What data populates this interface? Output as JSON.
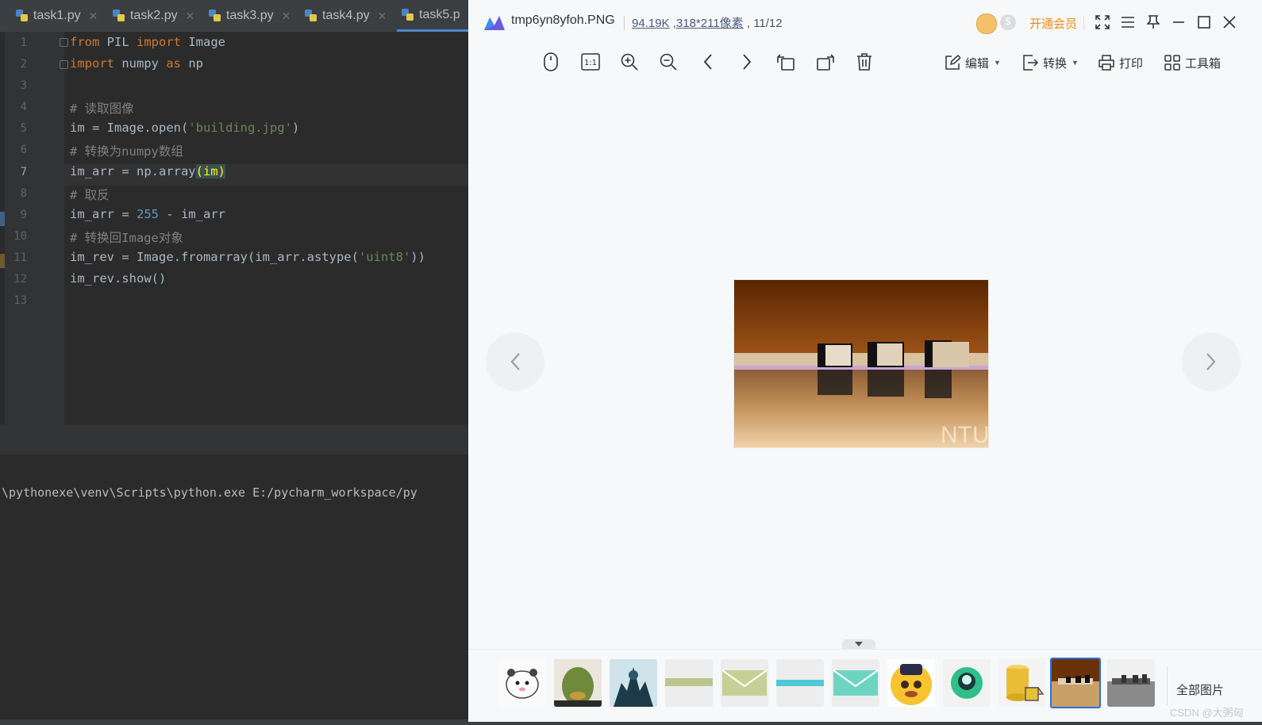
{
  "ide": {
    "tabs": [
      {
        "label": "task1.py"
      },
      {
        "label": "task2.py"
      },
      {
        "label": "task3.py"
      },
      {
        "label": "task4.py"
      },
      {
        "label": "task5.p"
      }
    ],
    "line_numbers": [
      "1",
      "2",
      "3",
      "4",
      "5",
      "6",
      "7",
      "8",
      "9",
      "10",
      "11",
      "12",
      "13"
    ],
    "current_line": "7",
    "code": {
      "l1": {
        "kw1": "from",
        "t1": " PIL ",
        "kw2": "import",
        "t2": " Image"
      },
      "l2": {
        "kw1": "import",
        "t1": " numpy ",
        "kw2": "as",
        "t2": " np"
      },
      "l4": "# 读取图像",
      "l5": {
        "t1": "im = Image.open(",
        "s": "'building.jpg'",
        "t2": ")"
      },
      "l6": "# 转换为numpy数组",
      "l7": {
        "t1": "im_arr = np.array",
        "h": "(im)"
      },
      "l8": "# 取反",
      "l9": {
        "t1": "im_arr = ",
        "n": "255",
        "t2": " - im_arr"
      },
      "l10": "# 转换回Image对象",
      "l11": {
        "t1": "im_rev = Image.fromarray(im_arr.astype(",
        "s": "'uint8'",
        "t2": "))"
      },
      "l12": "im_rev.show()"
    },
    "terminal_line": "\\pythonexe\\venv\\Scripts\\python.exe E:/pycharm_workspace/py"
  },
  "viewer": {
    "filename": "tmp6yn8yfoh.PNG",
    "filesize": "94.19K",
    "dimensions": "318*211像素",
    "position": "11/12",
    "vip_label": "开通会员",
    "tools": {
      "edit_label": "编辑",
      "convert_label": "转换",
      "print_label": "打印",
      "toolbox_label": "工具箱"
    },
    "all_images_label": "全部图片",
    "watermark": "CSDN @大粥匈"
  },
  "colors": {
    "ide_bg": "#2b2b2b",
    "viewer_bg": "#f7f8fa",
    "accent": "#2d6fd9",
    "vip": "#f28a18"
  }
}
